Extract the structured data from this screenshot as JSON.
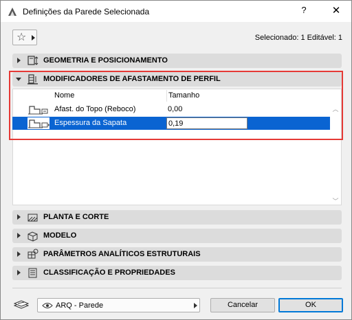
{
  "window": {
    "title": "Definições da Parede Selecionada",
    "help_label": "?",
    "close_label": "✕"
  },
  "toolbar": {
    "favorites_icon": "star-icon",
    "selected_info": "Selecionado: 1 Editável: 1"
  },
  "sections": {
    "geometry": {
      "label": "GEOMETRIA E POSICIONAMENTO",
      "icon": "geometry-icon",
      "expanded": false
    },
    "profile": {
      "label": "MODIFICADORES DE AFASTAMENTO DE PERFIL",
      "icon": "profile-modifier-icon",
      "expanded": true
    },
    "plan": {
      "label": "PLANTA E CORTE",
      "icon": "floor-plan-icon",
      "expanded": false
    },
    "model": {
      "label": "MODELO",
      "icon": "model-icon",
      "expanded": false
    },
    "analytical": {
      "label": "PARÂMETROS ANALÍTICOS ESTRUTURAIS",
      "icon": "structural-analysis-icon",
      "expanded": false
    },
    "classification": {
      "label": "CLASSIFICAÇÃO E PROPRIEDADES",
      "icon": "classification-icon",
      "expanded": false
    }
  },
  "table": {
    "columns": [
      "Nome",
      "Tamanho"
    ],
    "rows": [
      {
        "name": "Afast. do Topo (Reboco)",
        "value": "0,00",
        "selected": false
      },
      {
        "name": "Espessura da Sapata",
        "value": "0,19",
        "selected": true
      }
    ]
  },
  "footer": {
    "layer_label": "ARQ - Parede",
    "cancel_label": "Cancelar",
    "ok_label": "OK"
  },
  "colors": {
    "selection": "#0a64d2",
    "highlight_box": "#e53935"
  }
}
